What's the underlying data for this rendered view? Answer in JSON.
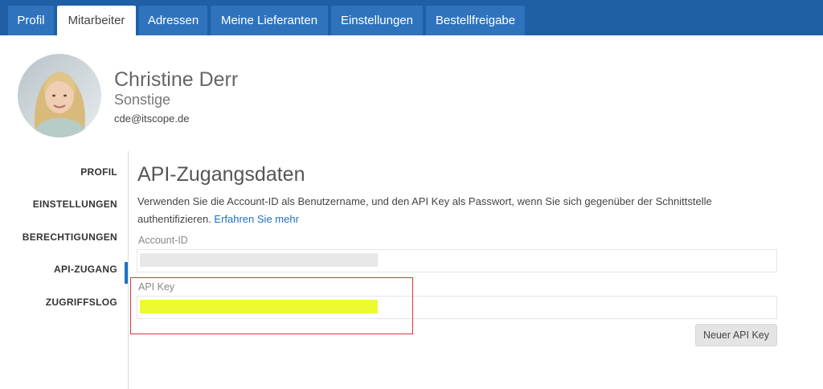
{
  "tabs": [
    {
      "label": "Profil",
      "active": false
    },
    {
      "label": "Mitarbeiter",
      "active": true
    },
    {
      "label": "Adressen",
      "active": false
    },
    {
      "label": "Meine Lieferanten",
      "active": false
    },
    {
      "label": "Einstellungen",
      "active": false
    },
    {
      "label": "Bestellfreigabe",
      "active": false
    }
  ],
  "profile": {
    "name": "Christine Derr",
    "role": "Sonstige",
    "email": "cde@itscope.de",
    "avatar": "user-photo"
  },
  "sidenav": [
    {
      "label": "PROFIL",
      "active": false
    },
    {
      "label": "EINSTELLUNGEN",
      "active": false
    },
    {
      "label": "BERECHTIGUNGEN",
      "active": false
    },
    {
      "label": "API-ZUGANG",
      "active": true
    },
    {
      "label": "ZUGRIFFSLOG",
      "active": false
    }
  ],
  "content": {
    "title": "API-Zugangsdaten",
    "description": "Verwenden Sie die Account-ID als Benutzername, und den API Key als Passwort, wenn Sie sich gegenüber der Schnittstelle authentifizieren.",
    "learn_more": "Erfahren Sie mehr",
    "account_id_label": "Account-ID",
    "account_id_value": "",
    "api_key_label": "API Key",
    "api_key_value": "",
    "new_key_button": "Neuer API Key"
  },
  "colors": {
    "nav_bar": "#1f5fa5",
    "tab": "#2f73bd",
    "accent": "#1f72c6",
    "highlight_border": "#d9363e",
    "redaction_yellow": "#ecfa30"
  }
}
